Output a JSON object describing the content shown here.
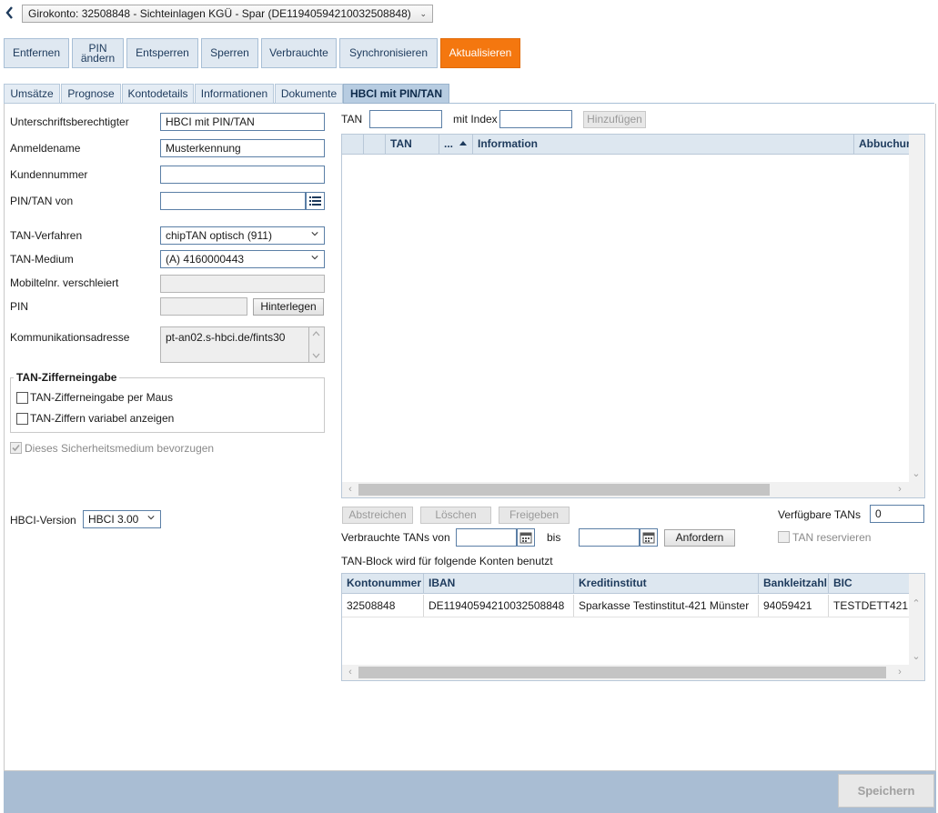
{
  "header": {
    "account_select": "Girokonto: 32508848 - Sichteinlagen KGÜ - Spar (DE11940594210032508848)"
  },
  "toolbar": {
    "entfernen": "Entfernen",
    "pin_aendern_line1": "PIN",
    "pin_aendern_line2": "ändern",
    "entsperren": "Entsperren",
    "sperren": "Sperren",
    "verbrauchte": "Verbrauchte",
    "synchronisieren": "Synchronisieren",
    "aktualisieren": "Aktualisieren",
    "accent_color": "#f4770f"
  },
  "tabs": [
    {
      "label": "Umsätze"
    },
    {
      "label": "Prognose"
    },
    {
      "label": "Kontodetails"
    },
    {
      "label": "Informationen"
    },
    {
      "label": "Dokumente"
    },
    {
      "label": "HBCI mit PIN/TAN",
      "active": true
    }
  ],
  "form": {
    "unterschrift_label": "Unterschriftsberechtigter",
    "unterschrift_value": "HBCI mit PIN/TAN",
    "anmeldename_label": "Anmeldename",
    "anmeldename_value": "Musterkennung",
    "kundennummer_label": "Kundennummer",
    "kundennummer_value": "",
    "pintan_von_label": "PIN/TAN von",
    "pintan_von_value": "",
    "tan_verfahren_label": "TAN-Verfahren",
    "tan_verfahren_value": "chipTAN optisch (911)",
    "tan_medium_label": "TAN-Medium",
    "tan_medium_value": "(A) 4160000443",
    "mobil_label": "Mobiltelnr. verschleiert",
    "mobil_value": "",
    "pin_label": "PIN",
    "pin_value": "",
    "hinterlegen": "Hinterlegen",
    "komm_label": "Kommunikationsadresse",
    "komm_value": "pt-an02.s-hbci.de/fints30",
    "ziffer_group_title": "TAN-Zifferneingabe",
    "ziffer_maus": "TAN-Zifferneingabe per Maus",
    "ziffer_variabel": "TAN-Ziffern variabel anzeigen",
    "bevorzugen": "Dieses Sicherheitsmedium bevorzugen",
    "hbci_version_label": "HBCI-Version",
    "hbci_version_value": "HBCI 3.00"
  },
  "tan_entry": {
    "tan_label": "TAN",
    "tan_value": "",
    "index_label": "mit Index",
    "index_value": "",
    "hinzufuegen": "Hinzufügen"
  },
  "tan_table": {
    "columns": [
      "TAN",
      "...",
      "Information",
      "Abbuchun"
    ],
    "rows": []
  },
  "tan_actions": {
    "abstreichen": "Abstreichen",
    "loeschen": "Löschen",
    "freigeben": "Freigeben",
    "verfuegbar_label": "Verfügbare TANs",
    "verfuegbar_value": "0",
    "verbrauchte_von_label": "Verbrauchte TANs von",
    "von_value": "",
    "bis_label": "bis",
    "bis_value": "",
    "anfordern": "Anfordern",
    "reservieren": "TAN reservieren"
  },
  "konten": {
    "caption": "TAN-Block wird für folgende Konten benutzt",
    "columns": [
      "Kontonummer",
      "IBAN",
      "Kreditinstitut",
      "Bankleitzahl",
      "BIC"
    ],
    "rows": [
      [
        "32508848",
        "DE11940594210032508848",
        "Sparkasse Testinstitut-421 Münster",
        "94059421",
        "TESTDETT421"
      ]
    ]
  },
  "footer": {
    "speichern": "Speichern"
  }
}
